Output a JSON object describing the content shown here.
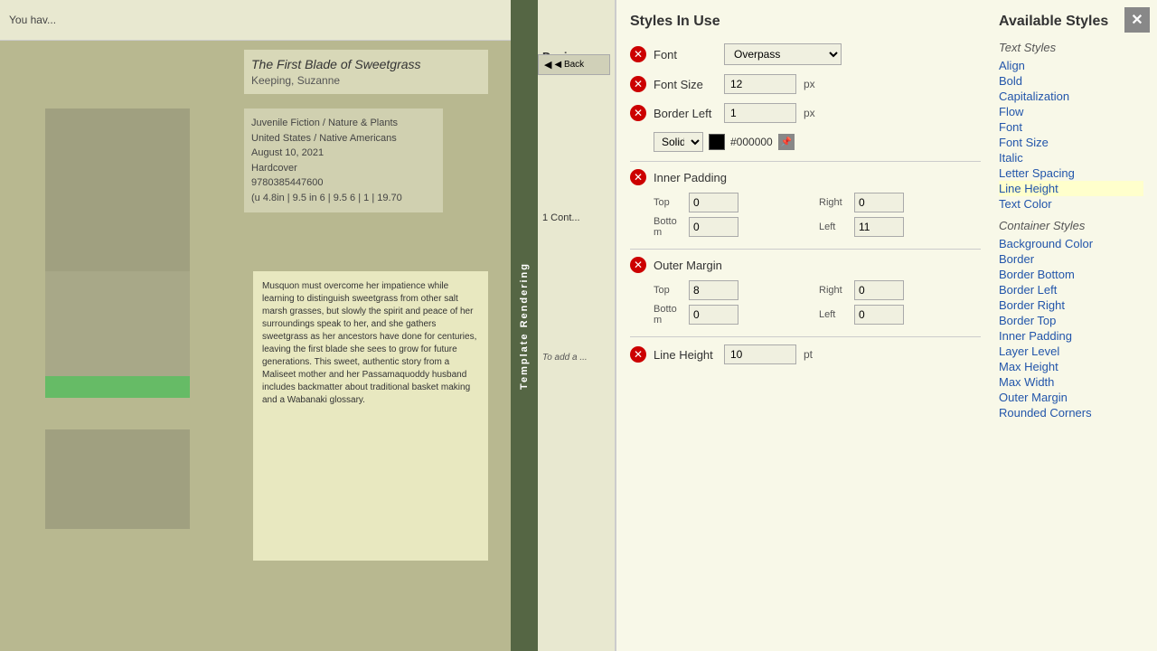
{
  "app": {
    "title": "Template Rendering",
    "close_btn": "✕"
  },
  "topbar": {
    "message": "You hav..."
  },
  "back_btn": "◀ Back",
  "design_tab": "Desig...",
  "book": {
    "title": "The First Blade of Sweetgrass",
    "author": "Keeping, Suzanne",
    "details": "Juvenile Fiction / Nature & Plants\nUnited States / Native Americans\nAugust 10, 2021\nHardcover\n9780385447600\n(u 4.8in | 9.5 in 6 | 9.5 6 | 1 | 19.70"
  },
  "description": "Musquon must overcome her impatience while learning to distinguish sweetgrass from other salt marsh grasses, but slowly the spirit and peace of her surroundings speak to her, and she gathers sweetgrass as her ancestors have done for centuries, leaving the first blade she sees to grow for future generations. This sweet, authentic story from a Maliseet mother and her Passamaquoddy husband includes backmatter about traditional basket making and a Wabanaki glossary.",
  "cont_label": "1 Cont...",
  "to_add_label": "To add a ...",
  "modal": {
    "styles_in_use_title": "Styles In Use",
    "available_styles_title": "Available Styles",
    "font_label": "Font",
    "font_value": "Overpass",
    "font_size_label": "Font Size",
    "font_size_value": "12",
    "font_size_unit": "px",
    "border_left_label": "Border Left",
    "border_left_value": "1",
    "border_left_unit": "px",
    "border_style": "Solid",
    "border_color_hex": "#000000",
    "inner_padding_label": "Inner Padding",
    "inner_padding_top_label": "Top",
    "inner_padding_top_value": "0",
    "inner_padding_right_label": "Right",
    "inner_padding_right_value": "0",
    "inner_padding_bottom_label": "Botto\nm",
    "inner_padding_bottom_value": "0",
    "inner_padding_left_label": "Left",
    "inner_padding_left_value": "11",
    "outer_margin_label": "Outer Margin",
    "outer_margin_top_label": "Top",
    "outer_margin_top_value": "8",
    "outer_margin_right_label": "Right",
    "outer_margin_right_value": "0",
    "outer_margin_bottom_label": "Botto\nm",
    "outer_margin_bottom_value": "0",
    "outer_margin_left_label": "Left",
    "outer_margin_left_value": "0",
    "line_height_label": "Line Height",
    "line_height_value": "10",
    "line_height_unit": "pt",
    "text_styles_category": "Text Styles",
    "available_items_text": [
      "Align",
      "Bold",
      "Capitalization",
      "Flow",
      "Font",
      "Font Size",
      "Italic",
      "Letter Spacing",
      "Line Height",
      "Text Color"
    ],
    "container_styles_category": "Container Styles",
    "available_items_container": [
      "Background Color",
      "Border",
      "Border Bottom",
      "Border Left",
      "Border Right",
      "Border Top",
      "Inner Padding",
      "Layer Level",
      "Max Height",
      "Max Width",
      "Outer Margin",
      "Rounded Corners"
    ]
  }
}
